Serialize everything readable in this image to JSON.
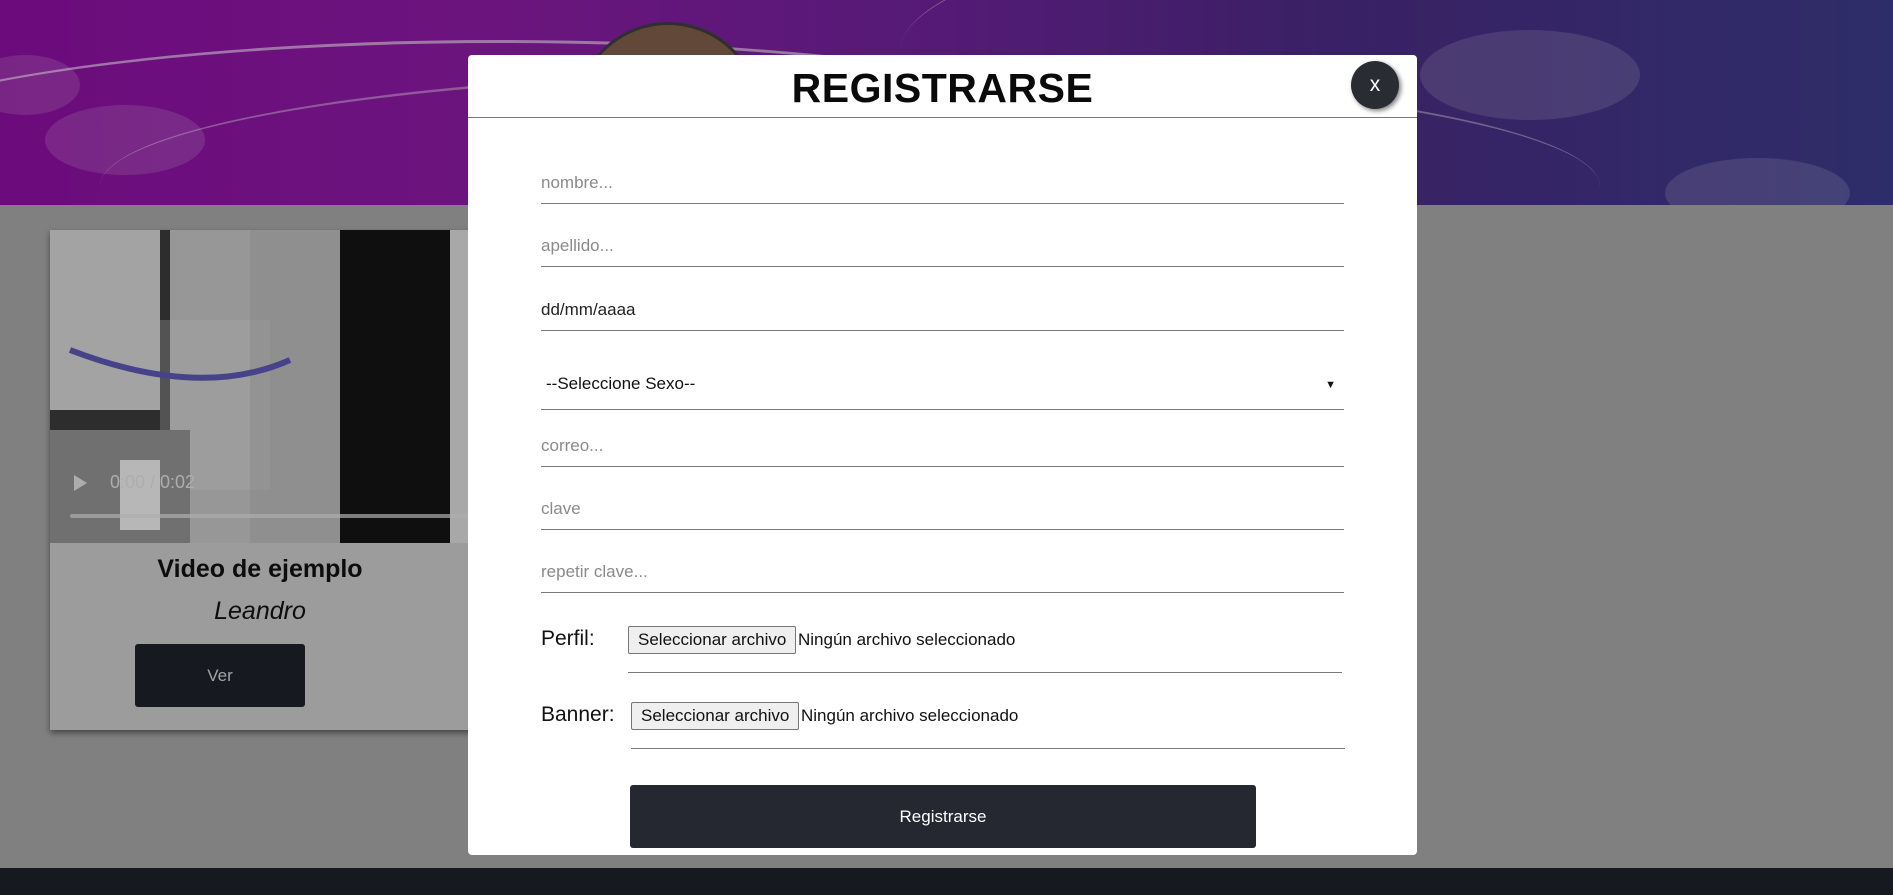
{
  "background": {
    "video_card": {
      "time": "0:00 / 0:02",
      "title": "Video de ejemplo",
      "author": "Leandro",
      "view_label": "Ver"
    }
  },
  "modal": {
    "title": "REGISTRARSE",
    "close_label": "x",
    "fields": {
      "nombre_placeholder": "nombre...",
      "apellido_placeholder": "apellido...",
      "fecha_value": "dd/mm/aaaa",
      "sexo_selected": "--Seleccione Sexo--",
      "correo_placeholder": "correo...",
      "clave_placeholder": "clave",
      "repetir_clave_placeholder": "repetir clave..."
    },
    "perfil": {
      "label": "Perfil:",
      "button": "Seleccionar archivo",
      "status": "Ningún archivo seleccionado"
    },
    "banner": {
      "label": "Banner:",
      "button": "Seleccionar archivo",
      "status": "Ningún archivo seleccionado"
    },
    "submit_label": "Registrarse"
  },
  "colors": {
    "banner_purple": "#8a0f9e",
    "banner_blue": "#3a3a86",
    "dark_button": "#252731",
    "footer": "#1e2029"
  },
  "icons": [
    "play-icon",
    "chevron-down-icon"
  ]
}
